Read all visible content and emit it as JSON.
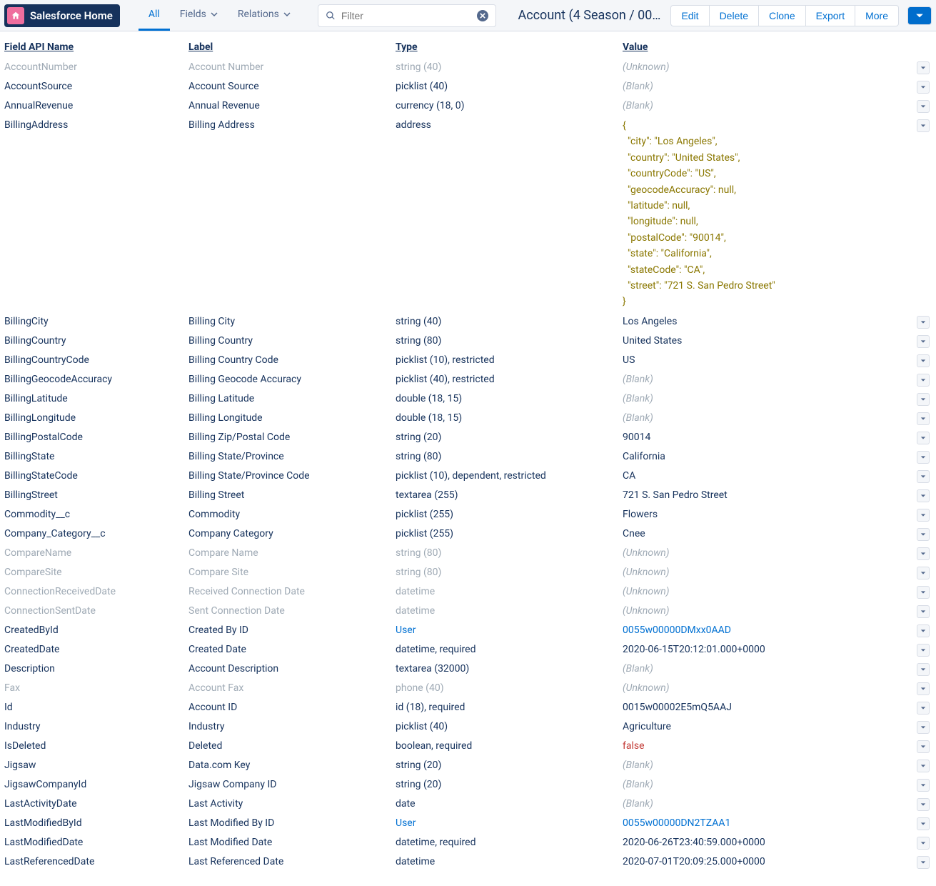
{
  "nav": {
    "home_label": "Salesforce Home",
    "tabs": [
      "All",
      "Fields",
      "Relations"
    ],
    "active_tab": 0,
    "filter_placeholder": "Filter"
  },
  "record_title": "Account (4 Season / 00…",
  "actions": {
    "edit": "Edit",
    "delete": "Delete",
    "clone": "Clone",
    "export": "Export",
    "more": "More"
  },
  "headers": {
    "api": "Field API Name",
    "label": "Label",
    "type": "Type",
    "value": "Value"
  },
  "billing_address_json_lines": [
    "{",
    "  \"city\": \"Los Angeles\",",
    "  \"country\": \"United States\",",
    "  \"countryCode\": \"US\",",
    "  \"geocodeAccuracy\": null,",
    "  \"latitude\": null,",
    "  \"longitude\": null,",
    "  \"postalCode\": \"90014\",",
    "  \"state\": \"California\",",
    "  \"stateCode\": \"CA\",",
    "  \"street\": \"721 S. San Pedro Street\"",
    "}"
  ],
  "rows": [
    {
      "api": "AccountNumber",
      "label": "Account Number",
      "type": "string (40)",
      "value": "(Unknown)",
      "vclass": "val-unknown",
      "muted": true
    },
    {
      "api": "AccountSource",
      "label": "Account Source",
      "type": "picklist (40)",
      "value": "(Blank)",
      "vclass": "val-blank"
    },
    {
      "api": "AnnualRevenue",
      "label": "Annual Revenue",
      "type": "currency (18, 0)",
      "value": "(Blank)",
      "vclass": "val-blank"
    },
    {
      "api": "BillingAddress",
      "label": "Billing Address",
      "type": "address",
      "value_mode": "json"
    },
    {
      "api": "BillingCity",
      "label": "Billing City",
      "type": "string (40)",
      "value": "Los Angeles"
    },
    {
      "api": "BillingCountry",
      "label": "Billing Country",
      "type": "string (80)",
      "value": "United States"
    },
    {
      "api": "BillingCountryCode",
      "label": "Billing Country Code",
      "type": "picklist (10), restricted",
      "value": "US"
    },
    {
      "api": "BillingGeocodeAccuracy",
      "label": "Billing Geocode Accuracy",
      "type": "picklist (40), restricted",
      "value": "(Blank)",
      "vclass": "val-blank"
    },
    {
      "api": "BillingLatitude",
      "label": "Billing Latitude",
      "type": "double (18, 15)",
      "value": "(Blank)",
      "vclass": "val-blank"
    },
    {
      "api": "BillingLongitude",
      "label": "Billing Longitude",
      "type": "double (18, 15)",
      "value": "(Blank)",
      "vclass": "val-blank"
    },
    {
      "api": "BillingPostalCode",
      "label": "Billing Zip/Postal Code",
      "type": "string (20)",
      "value": "90014"
    },
    {
      "api": "BillingState",
      "label": "Billing State/Province",
      "type": "string (80)",
      "value": "California"
    },
    {
      "api": "BillingStateCode",
      "label": "Billing State/Province Code",
      "type": "picklist (10), dependent, restricted",
      "value": "CA"
    },
    {
      "api": "BillingStreet",
      "label": "Billing Street",
      "type": "textarea (255)",
      "value": "721 S. San Pedro Street"
    },
    {
      "api": "Commodity__c",
      "label": "Commodity",
      "type": "picklist (255)",
      "value": "Flowers"
    },
    {
      "api": "Company_Category__c",
      "label": "Company Category",
      "type": "picklist (255)",
      "value": "Cnee"
    },
    {
      "api": "CompareName",
      "label": "Compare Name",
      "type": "string (80)",
      "value": "(Unknown)",
      "vclass": "val-unknown",
      "muted": true
    },
    {
      "api": "CompareSite",
      "label": "Compare Site",
      "type": "string (80)",
      "value": "(Unknown)",
      "vclass": "val-unknown",
      "muted": true
    },
    {
      "api": "ConnectionReceivedDate",
      "label": "Received Connection Date",
      "type": "datetime",
      "value": "(Unknown)",
      "vclass": "val-unknown",
      "muted": true
    },
    {
      "api": "ConnectionSentDate",
      "label": "Sent Connection Date",
      "type": "datetime",
      "value": "(Unknown)",
      "vclass": "val-unknown",
      "muted": true
    },
    {
      "api": "CreatedById",
      "label": "Created By ID",
      "type": "User",
      "type_link": true,
      "value": "0055w00000DMxx0AAD",
      "vclass": "val-link"
    },
    {
      "api": "CreatedDate",
      "label": "Created Date",
      "type": "datetime, required",
      "value": "2020-06-15T20:12:01.000+0000"
    },
    {
      "api": "Description",
      "label": "Account Description",
      "type": "textarea (32000)",
      "value": "(Blank)",
      "vclass": "val-blank"
    },
    {
      "api": "Fax",
      "label": "Account Fax",
      "type": "phone (40)",
      "value": "(Unknown)",
      "vclass": "val-unknown",
      "muted": true
    },
    {
      "api": "Id",
      "label": "Account ID",
      "type": "id (18), required",
      "value": "0015w00002E5mQ5AAJ"
    },
    {
      "api": "Industry",
      "label": "Industry",
      "type": "picklist (40)",
      "value": "Agriculture"
    },
    {
      "api": "IsDeleted",
      "label": "Deleted",
      "type": "boolean, required",
      "value": "false",
      "vclass": "val-false"
    },
    {
      "api": "Jigsaw",
      "label": "Data.com Key",
      "type": "string (20)",
      "value": "(Blank)",
      "vclass": "val-blank"
    },
    {
      "api": "JigsawCompanyId",
      "label": "Jigsaw Company ID",
      "type": "string (20)",
      "value": "(Blank)",
      "vclass": "val-blank"
    },
    {
      "api": "LastActivityDate",
      "label": "Last Activity",
      "type": "date",
      "value": "(Blank)",
      "vclass": "val-blank"
    },
    {
      "api": "LastModifiedById",
      "label": "Last Modified By ID",
      "type": "User",
      "type_link": true,
      "value": "0055w00000DN2TZAA1",
      "vclass": "val-link"
    },
    {
      "api": "LastModifiedDate",
      "label": "Last Modified Date",
      "type": "datetime, required",
      "value": "2020-06-26T23:40:59.000+0000"
    },
    {
      "api": "LastReferencedDate",
      "label": "Last Referenced Date",
      "type": "datetime",
      "value": "2020-07-01T20:09:25.000+0000"
    }
  ]
}
